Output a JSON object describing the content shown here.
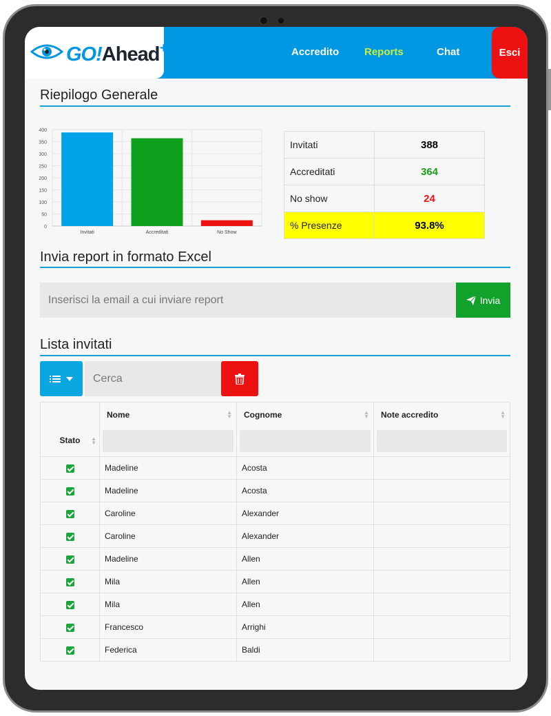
{
  "nav": {
    "logo": {
      "go": "GO!",
      "ahead": "Ahead",
      "plus": "+"
    },
    "links": [
      {
        "label": "Accredito",
        "active": false
      },
      {
        "label": "Reports",
        "active": true
      },
      {
        "label": "Chat",
        "active": false
      }
    ],
    "exit_label": "Esci"
  },
  "summary": {
    "title": "Riepilogo Generale",
    "stats": [
      {
        "label": "Invitati",
        "value": "388",
        "color": "#000000"
      },
      {
        "label": "Accreditati",
        "value": "364",
        "color": "#1a9e1a"
      },
      {
        "label": "No show",
        "value": "24",
        "color": "#ee1111"
      },
      {
        "label": "% Presenze",
        "value": "93.8%",
        "color": "#000000"
      }
    ]
  },
  "chart_data": {
    "type": "bar",
    "categories": [
      "Invitati",
      "Accreditati",
      "No Show"
    ],
    "values": [
      388,
      364,
      24
    ],
    "colors": [
      "#00a3e8",
      "#0fa01d",
      "#ee1111"
    ],
    "ylim": [
      0,
      400
    ],
    "yticks": [
      0,
      50,
      100,
      150,
      200,
      250,
      300,
      350,
      400
    ],
    "grid": true,
    "legend": "none"
  },
  "report": {
    "title": "Invia report in formato Excel",
    "email_placeholder": "Inserisci la email a cui inviare report",
    "send_label": "Invia"
  },
  "guests": {
    "title": "Lista invitati",
    "search_placeholder": "Cerca",
    "columns": {
      "stato": "Stato",
      "nome": "Nome",
      "cognome": "Cognome",
      "note": "Note accredito"
    },
    "rows": [
      {
        "checked": true,
        "nome": "Madeline",
        "cognome": "Acosta",
        "note": ""
      },
      {
        "checked": true,
        "nome": "Madeline",
        "cognome": "Acosta",
        "note": ""
      },
      {
        "checked": true,
        "nome": "Caroline",
        "cognome": "Alexander",
        "note": ""
      },
      {
        "checked": true,
        "nome": "Caroline",
        "cognome": "Alexander",
        "note": ""
      },
      {
        "checked": true,
        "nome": "Madeline",
        "cognome": "Allen",
        "note": ""
      },
      {
        "checked": true,
        "nome": "Mila",
        "cognome": "Allen",
        "note": ""
      },
      {
        "checked": true,
        "nome": "Mila",
        "cognome": "Allen",
        "note": ""
      },
      {
        "checked": true,
        "nome": "Francesco",
        "cognome": "Arrighi",
        "note": ""
      },
      {
        "checked": true,
        "nome": "Federica",
        "cognome": "Baldi",
        "note": ""
      }
    ]
  }
}
